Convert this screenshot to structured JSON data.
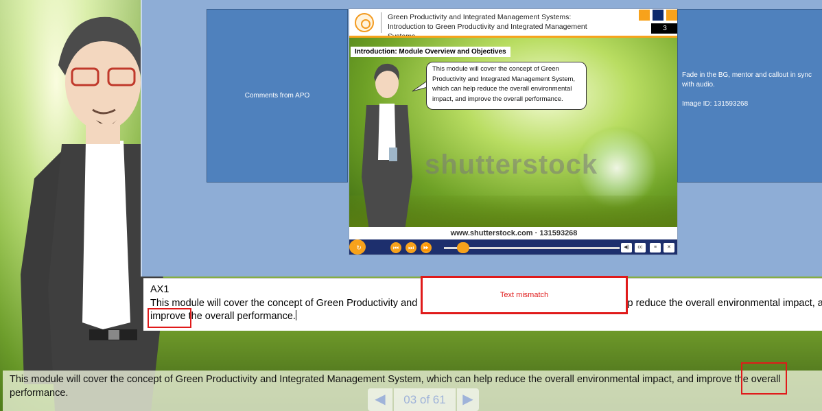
{
  "slide": {
    "title": "Green Productivity and Integrated Management Systems: Introduction to Green Productivity and Integrated Management Systems",
    "page_number": "3",
    "section_title": "Introduction:  Module Overview and Objectives",
    "callout_text": "This module will cover the concept of Green Productivity and Integrated Management System, which can help reduce the overall environmental impact, and improve the overall performance.",
    "watermark": "shutterstock",
    "stock_url": "www.shutterstock.com · 131593268",
    "accent_color": "#f7a21b",
    "header_dark_color": "#0d2a6e"
  },
  "apo_box": {
    "text": "Comments from APO"
  },
  "note_box": {
    "line1": "Fade in the BG, mentor and callout in sync with audio.",
    "line2": "Image ID: 131593268"
  },
  "player": {
    "icons": [
      "replay-icon",
      "play-icon",
      "previous-icon",
      "next-icon",
      "fast-forward-icon",
      "volume-icon",
      "cc-icon",
      "resources-icon",
      "close-icon"
    ],
    "seek_progress": 0.11
  },
  "notes": {
    "label": "AX1",
    "text": "This module will cover the concept of Green Productivity and Integrated Management System, which can help reduce  the overall environmental impact, and improve the overall performance."
  },
  "review": {
    "mismatch_label": "Text mismatch",
    "highlight_color": "#e01a1a"
  },
  "caption": {
    "text": "This module will cover the concept of Green Productivity and Integrated Management System, which can help reduce the overall environmental impact, and improve the overall performance."
  },
  "pager": {
    "label": "03 of 61",
    "prev": "◀",
    "next": "▶"
  }
}
